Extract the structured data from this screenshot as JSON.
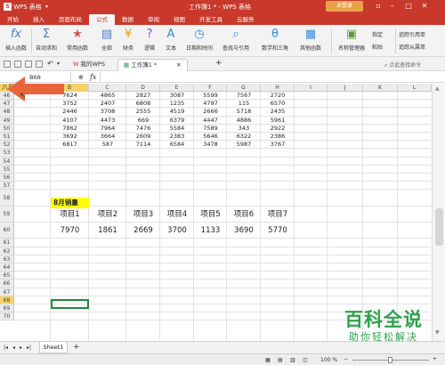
{
  "titlebar": {
    "app": "WPS 表格",
    "doc_title": "工作簿1 * - WPS 表格",
    "login": "未登录"
  },
  "menus": [
    "开始",
    "插入",
    "页面布局",
    "公式",
    "数据",
    "审阅",
    "视图",
    "开发工具",
    "云服务"
  ],
  "active_menu": "公式",
  "ribbon": {
    "insert_fn": "插入函数",
    "autosum": "自动求和",
    "common_fn": "常用函数",
    "all": "全部",
    "finance": "财务",
    "logic": "逻辑",
    "text": "文本",
    "datetime": "日期和时间",
    "lookup": "查找与引用",
    "math": "数学和三角",
    "other_fn": "其他函数",
    "name_mgr": "名称管理器",
    "specify": "指定",
    "paste": "粘贴",
    "trace_prec": "追踪引用单",
    "trace_dep": "追踪从属单"
  },
  "tabs": {
    "home": "我的WPS",
    "doc": "工作簿1 *",
    "search_placeholder": "点此查找命令"
  },
  "formula_bar": {
    "cell_ref": "B68",
    "fx": "fx"
  },
  "name_box_overlay": "八月销量",
  "columns": [
    "A",
    "B",
    "C",
    "D",
    "E",
    "F",
    "G",
    "H",
    "I",
    "J",
    "K",
    "L"
  ],
  "data_rows": [
    {
      "row": "46",
      "vals": [
        "7624",
        "4865",
        "2827",
        "3087",
        "5599",
        "7567",
        "2720"
      ]
    },
    {
      "row": "47",
      "vals": [
        "3752",
        "2407",
        "6808",
        "1235",
        "4797",
        "115",
        "6570"
      ]
    },
    {
      "row": "48",
      "vals": [
        "2446",
        "3708",
        "2555",
        "4519",
        "2666",
        "5718",
        "2435"
      ]
    },
    {
      "row": "49",
      "vals": [
        "4107",
        "4473",
        "669",
        "6379",
        "4447",
        "4886",
        "5961"
      ]
    },
    {
      "row": "50",
      "vals": [
        "7862",
        "7964",
        "7476",
        "5584",
        "7589",
        "343",
        "2922"
      ]
    },
    {
      "row": "51",
      "vals": [
        "3692",
        "3664",
        "2609",
        "2383",
        "5646",
        "6322",
        "2386"
      ]
    },
    {
      "row": "52",
      "vals": [
        "6817",
        "587",
        "7114",
        "6584",
        "3478",
        "5987",
        "3767"
      ]
    }
  ],
  "empty_rows_a": [
    "53",
    "54",
    "55",
    "56",
    "57"
  ],
  "row58": "58",
  "row59": "59",
  "row60": "60",
  "empty_rows_b": [
    "61",
    "62",
    "63",
    "64",
    "65",
    "66",
    "67",
    "68",
    "69",
    "70"
  ],
  "summary_title": "8月销量",
  "summary_headers": [
    "项目1",
    "项目2",
    "项目3",
    "项目4",
    "项目5",
    "项目6",
    "项目7"
  ],
  "summary_values": [
    "7970",
    "1861",
    "2669",
    "3700",
    "1133",
    "3690",
    "5770"
  ],
  "sheet_tab": "Sheet1",
  "zoom": "100 %",
  "watermark": {
    "line1": "百科全说",
    "line2": "助你轻松解决"
  }
}
